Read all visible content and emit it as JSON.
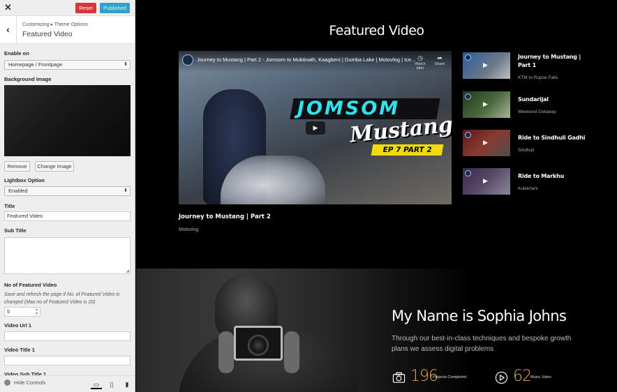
{
  "topbar": {
    "close_icon": "close-icon",
    "reset_label": "Reset",
    "published_label": "Published",
    "reset_color": "#d63638",
    "published_color": "#2ea2cc"
  },
  "panel_header": {
    "breadcrumb": "Customizing ▸ Theme Options",
    "section_title": "Featured Video",
    "back_icon": "chevron-left-icon"
  },
  "fields": {
    "enable_on": {
      "label": "Enable on",
      "value": "Homepage / Frontpage"
    },
    "background_image": {
      "label": "Background Image",
      "remove_label": "Remove",
      "change_label": "Change Image"
    },
    "lightbox": {
      "label": "Lightbox Option",
      "value": "Enabled"
    },
    "title": {
      "label": "Title",
      "value": "Featured Video"
    },
    "sub_title": {
      "label": "Sub Title",
      "value": ""
    },
    "count": {
      "label": "No of Featured Video",
      "help": "Save and refresh the page if No. of Featured Video is changed (Max no of Featured Video is 20)",
      "value": "5"
    },
    "video_url_1": {
      "label": "Video Url 1",
      "value": ""
    },
    "video_title_1": {
      "label": "Video Title 1",
      "value": ""
    },
    "video_sub_title_1": {
      "label": "Video Sub Title 1"
    }
  },
  "footer": {
    "hide_controls_label": "Hide Controls",
    "devices": [
      "desktop-icon",
      "tablet-icon",
      "mobile-icon"
    ],
    "active_device": "desktop"
  },
  "preview": {
    "section_title": "Featured Video",
    "player": {
      "title": "Journey to Mustang | Part 2 - Jomsom to Muktinath, Kaagbeni | Dumba Lake | Motovlog | Ice...",
      "watch_later": "Watch later",
      "share": "Share",
      "overlay_word_1": "JOMSOM",
      "overlay_word_2": "Mustang",
      "overlay_badge": "EP 7 PART 2"
    },
    "main_caption": "Journey to Mustang | Part 2",
    "main_subcaption": "Motovlog",
    "playlist": [
      {
        "title": "Journey to Mustang | Part 1",
        "subtitle": "KTM to Rupse Falls"
      },
      {
        "title": "Sundarijal",
        "subtitle": "Weekend Getaway"
      },
      {
        "title": "Ride to Sindhuli Gadhi",
        "subtitle": "Sindhuli"
      },
      {
        "title": "Ride to Markhu",
        "subtitle": "Kulekhani"
      }
    ],
    "about": {
      "name": "My Name is Sophia Johns",
      "description": "Through our best-in-class techniques and bespoke growth plans we assess digital problems",
      "stats": [
        {
          "icon": "camera-icon",
          "value": "196",
          "label": "Projects Completed"
        },
        {
          "icon": "play-circle-icon",
          "value": "62",
          "label": "Music Video"
        }
      ],
      "accent_color": "#e8b04a"
    }
  }
}
